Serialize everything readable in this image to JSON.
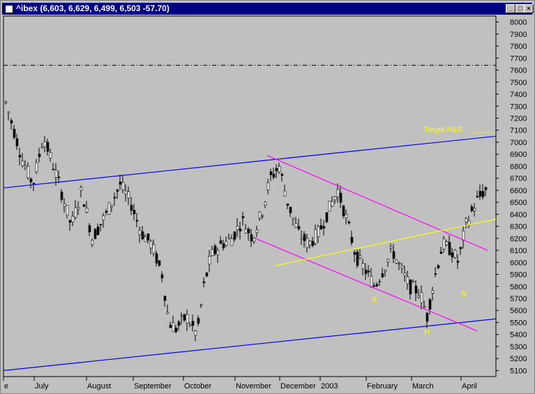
{
  "window": {
    "title": "^ibex (6,603, 6,629, 6,499, 6,503 -57.70)",
    "buttons": [
      "minimize",
      "maximize"
    ]
  },
  "chart_data": {
    "type": "candlestick",
    "y_ticks": [
      5100,
      5200,
      5300,
      5400,
      5500,
      5600,
      5700,
      5800,
      5900,
      6000,
      6100,
      6200,
      6300,
      6400,
      6500,
      6600,
      6700,
      6800,
      6900,
      7000,
      7100,
      7200,
      7300,
      7400,
      7500,
      7600,
      7700,
      7800,
      7900,
      8000
    ],
    "ylim": [
      5050,
      8050
    ],
    "x_labels": [
      "e",
      "July",
      "August",
      "September",
      "October",
      "November",
      "December",
      "2003",
      "February",
      "March",
      "April"
    ],
    "reference_line": 7640,
    "annotations": [
      "Target H&S",
      "S",
      "H",
      "S"
    ],
    "trendlines_upper": [
      [
        0,
        6620
      ],
      [
        710,
        7050
      ]
    ],
    "trendlines_lower": [
      [
        0,
        5100
      ],
      [
        710,
        5530
      ]
    ],
    "colors": {
      "background": "#c0c0c0",
      "candles": "#000000",
      "channel": "#0000ff",
      "pink": "#ff00ff",
      "neckline": "#ffff00",
      "annotation": "#ffff00"
    }
  }
}
